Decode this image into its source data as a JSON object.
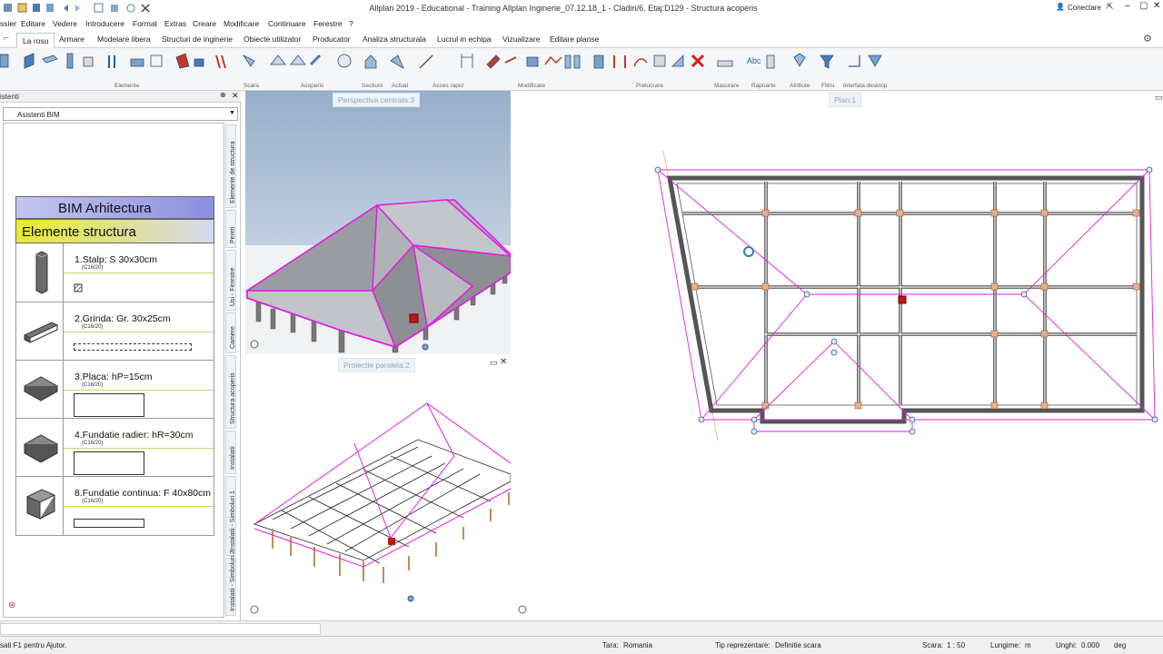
{
  "title_bar": {
    "title": "Allplan 2019 - Educational - Training Allplan Inginerie_07.12.18_1 - Cladiri/6. Etaj:D129 - Structura acoperis",
    "connect_label": "Conectare"
  },
  "menu": {
    "items": [
      "ssier",
      "Editare",
      "Vedere",
      "Introducere",
      "Format",
      "Extras",
      "Creare",
      "Modificare",
      "Continuare",
      "Ferestre",
      "?"
    ]
  },
  "tabs": {
    "items": [
      "La rosu",
      "Armare",
      "Modelare libera",
      "Structuri de inginerie",
      "Obiecte utilizator",
      "Producator",
      "Analiza structurala",
      "Lucrul in echipa",
      "Vizualizare",
      "Editare planse"
    ],
    "active": "La rosu"
  },
  "ribbon": {
    "groups": [
      "Elemente",
      "Scara",
      "Acoperis",
      "Sectiuni",
      "Actual",
      "Acces rapid",
      "Modificare",
      "Prelucrare",
      "Masurare",
      "Rapoarte",
      "Atribute",
      "Filtru",
      "Interfata desktop"
    ],
    "abc_label": "Abc"
  },
  "left_panel": {
    "header": "istenti",
    "dropdown_value": "Asistenti BIM",
    "vertical_tabs": [
      "Elemente de structura",
      "Pereti",
      "Usi - Ferestre",
      "Camere",
      "Structura acoperis",
      "Instalatii",
      "Instalatii - Simboluri 1",
      "Instalatii - Simboluri 2"
    ],
    "bim_title": "BIM Arhitectura",
    "bim_subtitle": "Elemente structura",
    "elements": [
      {
        "name": "1.Stalp: S 30x30cm",
        "material": "(C16/20)"
      },
      {
        "name": "2.Grinda: Gr. 30x25cm",
        "material": "(C16/20)"
      },
      {
        "name": "3.Placa: hP=15cm",
        "material": "(C16/20)"
      },
      {
        "name": "4.Fundatie radier: hR=30cm",
        "material": "(C16/20)"
      },
      {
        "name": "8.Fundatie continua: F 40x80cm",
        "material": "(C16/20)"
      }
    ]
  },
  "views": {
    "perspective_label": "Perspectiva centrala:3",
    "parallel_label": "Proiectie paralela:2",
    "plan_label": "Plan:1"
  },
  "status_bar": {
    "help": "sati F1 pentru Ajutor.",
    "country_label": "Tara:",
    "country_value": "Romania",
    "representation_label": "Tip reprezentare:",
    "representation_value": "Definitie scara",
    "scale_label": "Scara:",
    "scale_value": "1 : 50",
    "length_label": "Lungime:",
    "length_value": "m",
    "angle_label": "Unghi:",
    "angle_value": "0.000",
    "angle_unit": "deg"
  },
  "colors": {
    "accent": "#1d5fa8",
    "roof_pink": "#e020e0",
    "bim_header": "#a4a6ee",
    "bim_subheader": "#e0e430"
  }
}
